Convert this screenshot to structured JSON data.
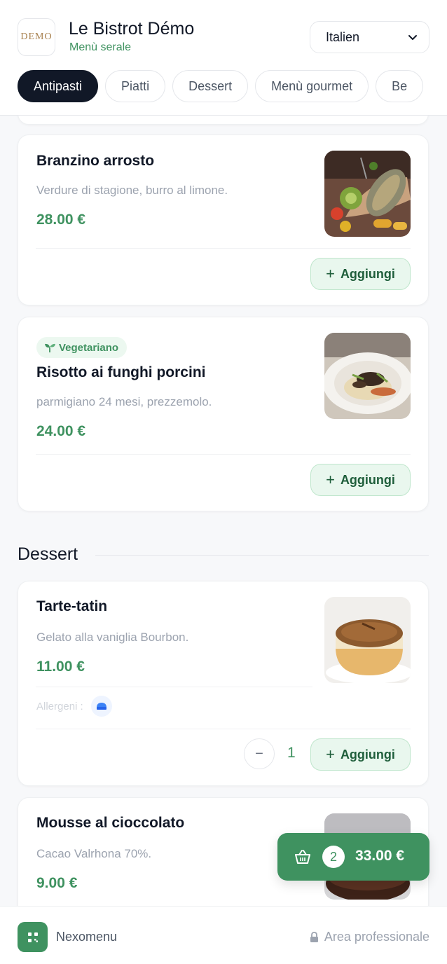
{
  "header": {
    "logo_text": "DEMO",
    "title": "Le Bistrot Démo",
    "subtitle": "Menù serale",
    "language": "Italien"
  },
  "tabs": [
    "Antipasti",
    "Piatti",
    "Dessert",
    "Menù gourmet",
    "Be"
  ],
  "active_tab": "Antipasti",
  "dishes": [
    {
      "name": "Branzino arrosto",
      "desc": "Verdure di stagione, burro al limone.",
      "price": "28.00 €",
      "add_label": "Aggiungi",
      "image": "roasted-sea-bass-photo"
    },
    {
      "badge": "Vegetariano",
      "name": "Risotto ai funghi porcini",
      "desc": "parmigiano 24 mesi, prezzemolo.",
      "price": "24.00 €",
      "add_label": "Aggiungi",
      "image": "mushroom-risotto-photo"
    }
  ],
  "dessert_section": {
    "title": "Dessert",
    "items": [
      {
        "name": "Tarte-tatin",
        "desc": "Gelato alla vaniglia Bourbon.",
        "price": "11.00 €",
        "allergens_label": "Allergeni :",
        "allergen_icon": "milk-allergen-icon",
        "quantity": "1",
        "qty_minus": "−",
        "add_label": "Aggiungi",
        "image": "tarte-tatin-photo"
      },
      {
        "name": "Mousse al cioccolato",
        "desc": "Cacao Valrhona 70%.",
        "price": "9.00 €",
        "image": "chocolate-mousse-photo"
      }
    ]
  },
  "cart": {
    "count": "2",
    "total": "33.00 €",
    "icon": "basket-icon"
  },
  "footer": {
    "brand": "Nexomenu",
    "pro_link": "Area professionale"
  },
  "colors": {
    "accent": "#3f9260",
    "dark": "#111827",
    "muted": "#9ca3af",
    "add_bg": "#e9f7ee"
  }
}
